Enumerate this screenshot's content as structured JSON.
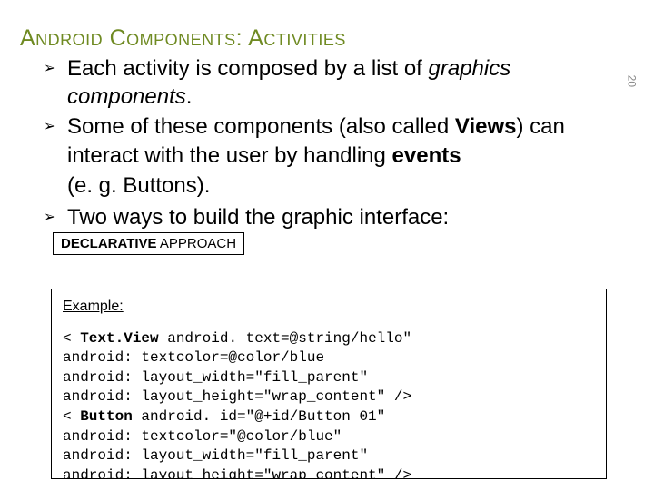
{
  "title": "Android Components: Activities",
  "bullets": {
    "b1_pre": "Each activity is composed by a list of ",
    "b1_em1": "graphics components",
    "b1_post": ".",
    "b2_pre": "Some of these components (also called ",
    "b2_bold1": "Views",
    "b2_mid": ") can interact with the user by handling ",
    "b2_bold2": "events",
    "eg": "(e. g. Buttons).",
    "b3": "Two ways to build the graphic interface:"
  },
  "tag_bold": "DECLARATIVE",
  "tag_rest": " APPROACH",
  "codebox": {
    "example_label": "Example:",
    "lines": [
      "< Text.View android. text=@string/hello\"",
      "android: textcolor=@color/blue",
      "android: layout_width=\"fill_parent\"",
      "android: layout_height=\"wrap_content\" />",
      "< Button android. id=\"@+id/Button 01\"",
      "android: textcolor=\"@color/blue\"",
      "android: layout_width=\"fill_parent\"",
      "android: layout_height=\"wrap_content\" />"
    ],
    "bold_tokens": [
      "Text.View",
      "Button"
    ]
  },
  "page_number": "20"
}
